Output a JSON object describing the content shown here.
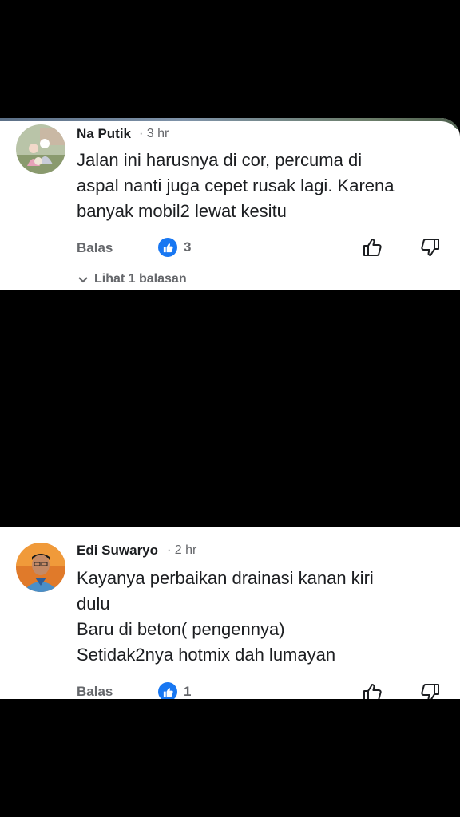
{
  "comments": [
    {
      "author": "Na Putik",
      "time": "· 3 hr",
      "lines": [
        "Jalan ini harusnya di cor, percuma di",
        "aspal nanti juga cepet rusak lagi. Karena",
        "banyak mobil2 lewat kesitu"
      ],
      "reply_label": "Balas",
      "reaction_count": "3",
      "view_replies": "Lihat 1 balasan"
    },
    {
      "author": "Edi Suwaryo",
      "time": "· 2 hr",
      "lines": [
        "Kayanya perbaikan drainasi kanan kiri",
        "dulu",
        "Baru di beton( pengennya)",
        "Setidak2nya hotmix dah lumayan"
      ],
      "reply_label": "Balas",
      "reaction_count": "1"
    }
  ],
  "colors": {
    "like_blue": "#1877f2",
    "text_primary": "#1c1e21",
    "text_secondary": "#65676b"
  },
  "icons": [
    "like-icon",
    "thumbs-up-icon",
    "thumbs-down-icon",
    "chevron-down-icon"
  ]
}
